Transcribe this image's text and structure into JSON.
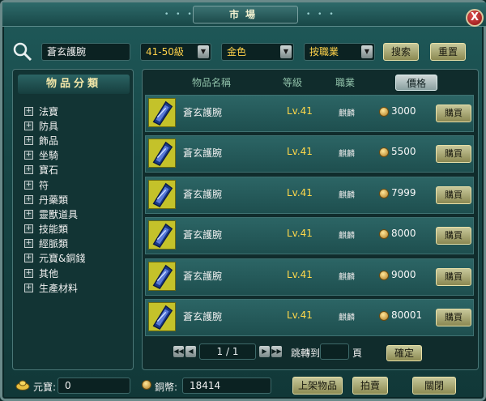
{
  "window": {
    "title": "市場",
    "close_label": "X"
  },
  "search": {
    "value": "蒼玄護腕",
    "level_filter": "41-50級",
    "color_filter": "金色",
    "sort_filter": "按職業",
    "search_label": "搜索",
    "reset_label": "重置"
  },
  "categories": {
    "header": "物品分類",
    "items": [
      "法寶",
      "防具",
      "飾品",
      "坐騎",
      "寶石",
      "符",
      "丹藥類",
      "靈獸道具",
      "技能類",
      "經脈類",
      "元寶&銅錢",
      "其他",
      "生產材料"
    ]
  },
  "table": {
    "columns": [
      "物品名稱",
      "等級",
      "職業",
      "價格"
    ],
    "active_column": "價格",
    "rows": [
      {
        "name": "蒼玄護腕",
        "level": "Lv.41",
        "job": "麒麟",
        "price": "3000",
        "action": "購買"
      },
      {
        "name": "蒼玄護腕",
        "level": "Lv.41",
        "job": "麒麟",
        "price": "5500",
        "action": "購買"
      },
      {
        "name": "蒼玄護腕",
        "level": "Lv.41",
        "job": "麒麟",
        "price": "7999",
        "action": "購買"
      },
      {
        "name": "蒼玄護腕",
        "level": "Lv.41",
        "job": "麒麟",
        "price": "8000",
        "action": "購買"
      },
      {
        "name": "蒼玄護腕",
        "level": "Lv.41",
        "job": "麒麟",
        "price": "9000",
        "action": "購買"
      },
      {
        "name": "蒼玄護腕",
        "level": "Lv.41",
        "job": "麒麟",
        "price": "80001",
        "action": "購買"
      }
    ]
  },
  "pager": {
    "page_text": "1 / 1",
    "jump_label": "跳轉到",
    "page_unit": "頁",
    "confirm_label": "確定"
  },
  "footer": {
    "yuanbao_label": "元寶:",
    "yuanbao_value": "0",
    "copper_label": "銅幣:",
    "copper_value": "18414",
    "list_item_label": "上架物品",
    "auction_label": "拍賣",
    "close_label": "關閉"
  },
  "colors": {
    "accent_gold": "#ffd84a",
    "panel": "#123434",
    "row": "#2c6565"
  }
}
